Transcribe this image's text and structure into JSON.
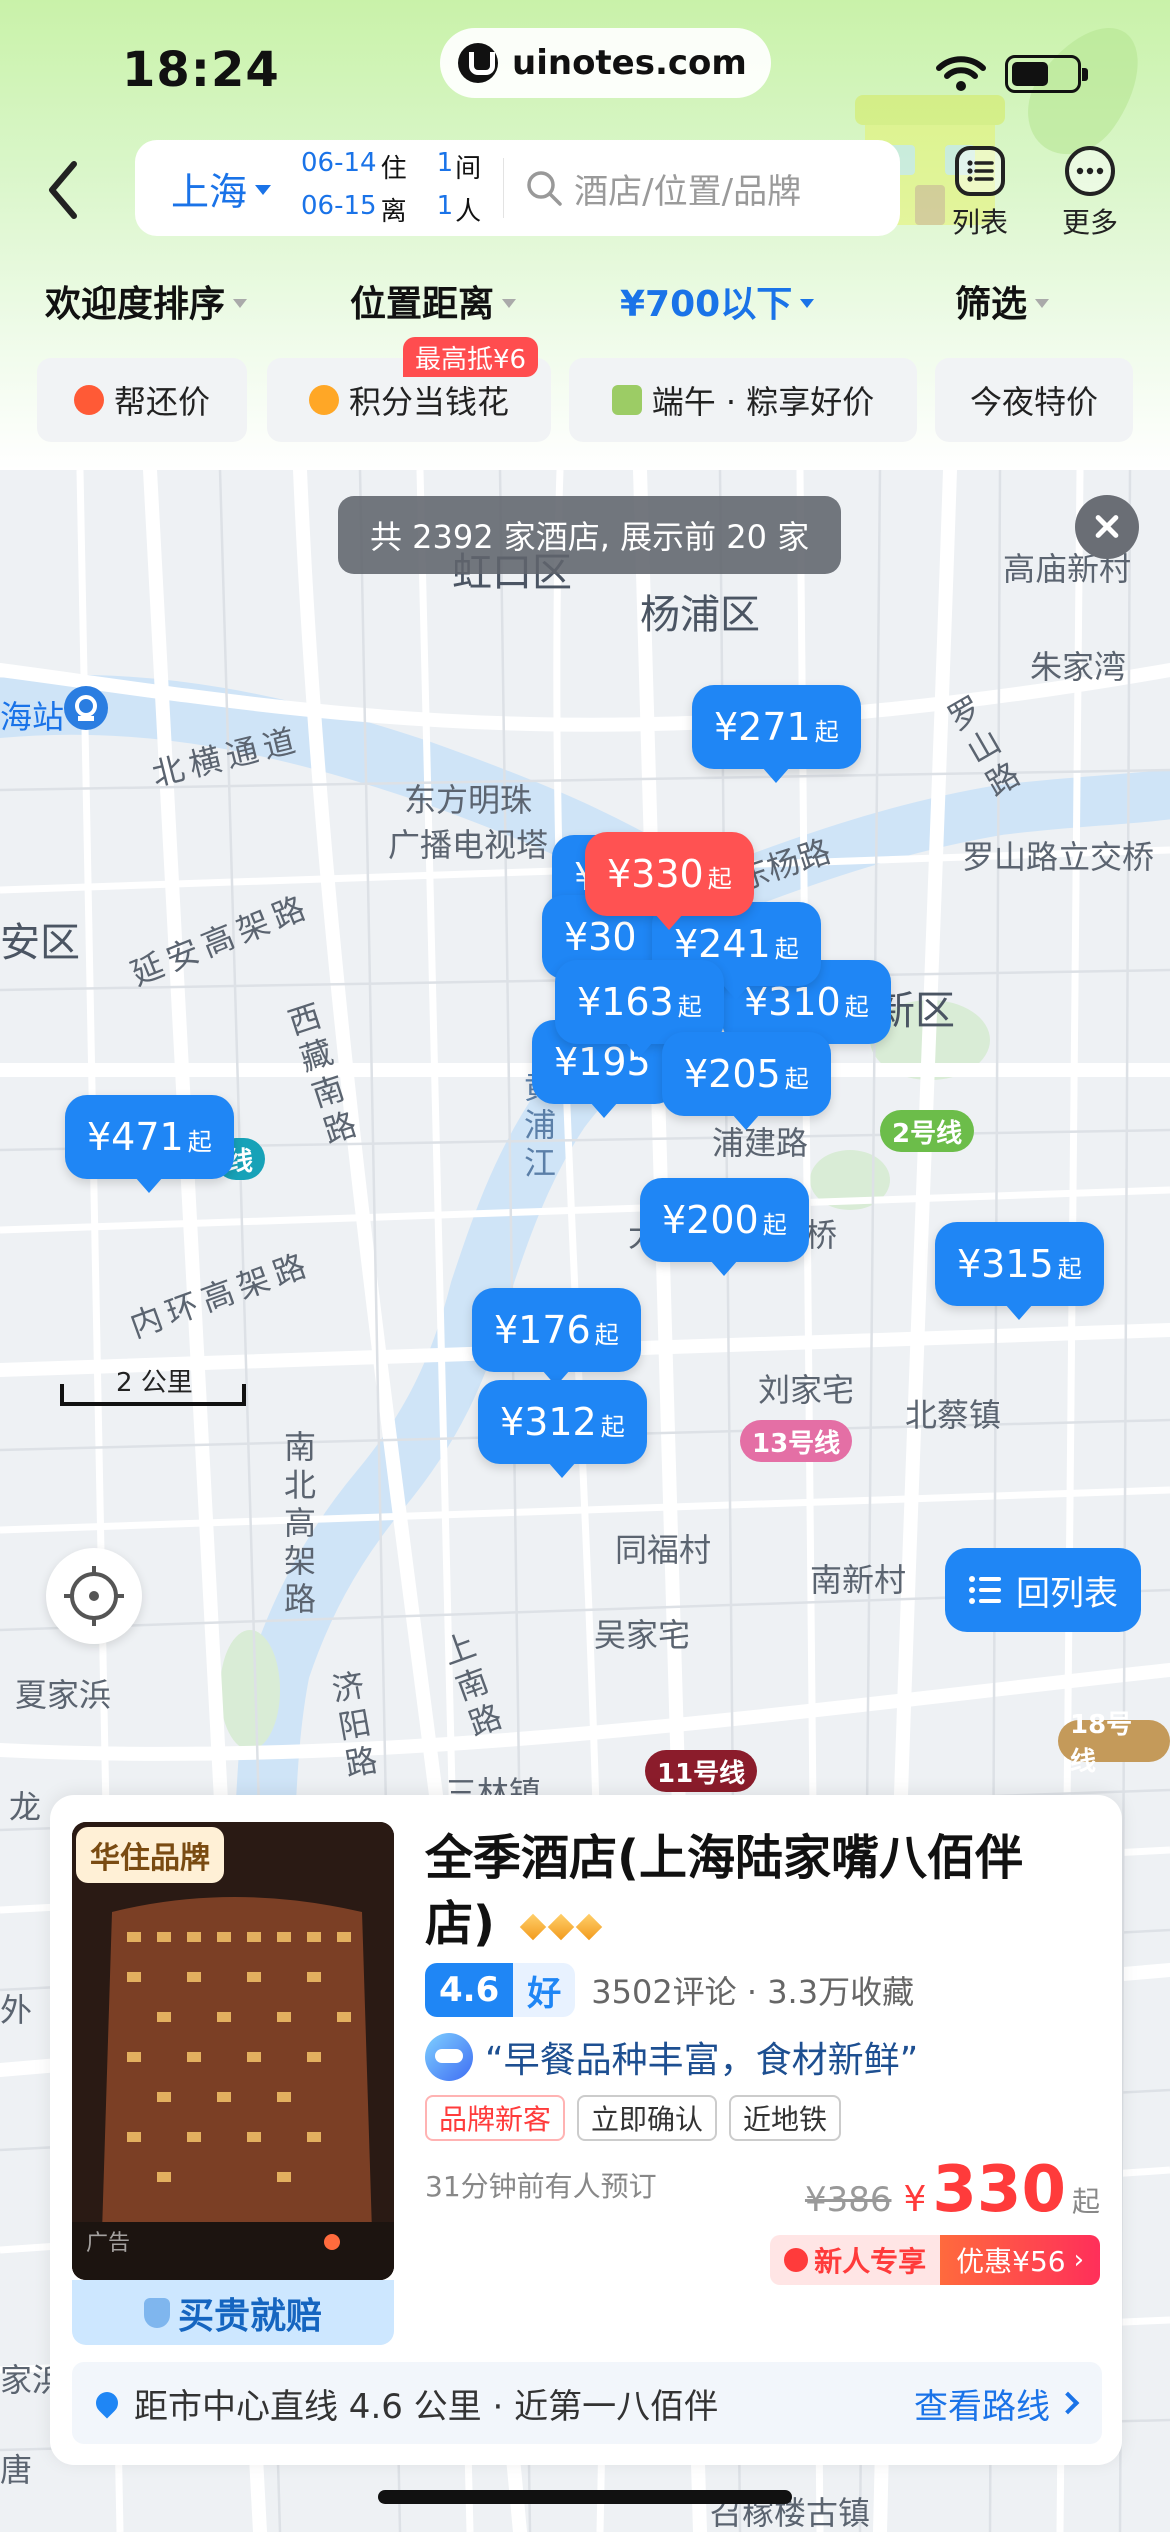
{
  "status_bar": {
    "time": "18:24",
    "url": "uinotes.com",
    "wifi_icon": "wifi-icon",
    "battery_icon": "battery-icon",
    "battery_level": 0.58
  },
  "search": {
    "city": "上海",
    "checkin_date": "06-14",
    "checkin_label": "住",
    "checkout_date": "06-15",
    "checkout_label": "离",
    "rooms_count": "1",
    "rooms_unit": "间",
    "guests_count": "1",
    "guests_unit": "人",
    "placeholder": "酒店/位置/品牌"
  },
  "top_actions": {
    "list_label": "列表",
    "more_label": "更多"
  },
  "filters": [
    {
      "label": "欢迎度排序",
      "active": false
    },
    {
      "label": "位置距离",
      "active": false
    },
    {
      "label": "¥700以下",
      "active": true
    },
    {
      "label": "筛选",
      "active": false
    }
  ],
  "chips": [
    {
      "label": "帮还价",
      "icon": "discount-icon",
      "color": "#ff5a36"
    },
    {
      "label": "积分当钱花",
      "icon": "points-icon",
      "color": "#ffa726",
      "badge": "最高抵¥6"
    },
    {
      "label": "端午 · 粽享好价",
      "icon": "zongzi-icon",
      "color": "#9ccc65"
    },
    {
      "label": "今夜特价",
      "icon": "",
      "color": ""
    }
  ],
  "map": {
    "hotel_count_text": "共 2392 家酒店, 展示前 20 家",
    "scale_label": "2 公里",
    "back_to_list_label": "回列表",
    "labels": {
      "hongkou": "虹口区",
      "yangpu": "杨浦区",
      "gaomiao": "高庙新村",
      "zhujiawan": "朱家湾",
      "station": "海站",
      "beiheng": "北横通道",
      "dongfang1": "东方明珠",
      "dongfang2": "广播电视塔",
      "luoshan": "罗山路",
      "luoshan_interchange": "罗山路立交桥",
      "jingan": "安区",
      "yanan": "延安高架路",
      "xizang": "西藏南路",
      "yangshu": "东杨路",
      "pudong": "东新区",
      "huangpujiang": "黄浦江",
      "pujian": "浦建路",
      "qiao": "桥",
      "da": "大",
      "neihuan": "内环高架路",
      "liujia": "刘家宅",
      "beicai": "北蔡镇",
      "nanbei": "南北高架路",
      "tongfu": "同福村",
      "nanxin": "南新村",
      "wujia": "吴家宅",
      "shangnan": "上南路",
      "jiyang": "济阳路",
      "xiajia": "夏家浜",
      "sanlin": "三林镇",
      "long": "龙",
      "wai": "外",
      "jiabang": "家浜",
      "tang": "唐",
      "zhaojia": "召稼楼古镇"
    },
    "metro": [
      {
        "label": "2号线",
        "color": "#6cbd4a"
      },
      {
        "label": "13号线",
        "color": "#e46fa5"
      },
      {
        "label": "11号线",
        "color": "#8b1c2b"
      },
      {
        "label": "18号线",
        "color": "#c49a5a"
      },
      {
        "label": "线",
        "color": "#17a2b8"
      }
    ],
    "pins": [
      {
        "price": "¥271",
        "suffix": "起",
        "selected": false
      },
      {
        "price": "¥3",
        "suffix": "",
        "selected": false
      },
      {
        "price": "¥30",
        "suffix": "",
        "selected": false
      },
      {
        "price": "¥241",
        "suffix": "起",
        "selected": false
      },
      {
        "price": "¥310",
        "suffix": "起",
        "selected": false
      },
      {
        "price": "¥163",
        "suffix": "起",
        "selected": false
      },
      {
        "price": "¥195",
        "suffix": "",
        "selected": false
      },
      {
        "price": "¥205",
        "suffix": "起",
        "selected": false
      },
      {
        "price": "¥330",
        "suffix": "起",
        "selected": true
      },
      {
        "price": "¥471",
        "suffix": "起",
        "selected": false
      },
      {
        "price": "¥200",
        "suffix": "起",
        "selected": false
      },
      {
        "price": "¥315",
        "suffix": "起",
        "selected": false
      },
      {
        "price": "¥176",
        "suffix": "起",
        "selected": false
      },
      {
        "price": "¥312",
        "suffix": "起",
        "selected": false
      }
    ]
  },
  "hotel_card": {
    "brand_tag": "华住品牌",
    "ad_tag": "广告",
    "guarantee": "买贵就赔",
    "name": "全季酒店(上海陆家嘴八佰伴店)",
    "diamond_count": 3,
    "score": "4.6",
    "score_word": "好",
    "reviews": "3502评论 · 3.3万收藏",
    "quote": "“早餐品种丰富，食材新鲜”",
    "tags": [
      {
        "label": "品牌新客",
        "style": "red"
      },
      {
        "label": "立即确认",
        "style": "normal"
      },
      {
        "label": "近地铁",
        "style": "normal"
      }
    ],
    "booked_text": "31分钟前有人预订",
    "old_price": "¥386",
    "currency": "¥",
    "price": "330",
    "price_suffix": "起",
    "promo_left": "新人专享",
    "promo_right": "优惠¥56",
    "distance_text": "距市中心直线 4.6 公里 · 近第一八佰伴",
    "route_label": "查看路线"
  }
}
